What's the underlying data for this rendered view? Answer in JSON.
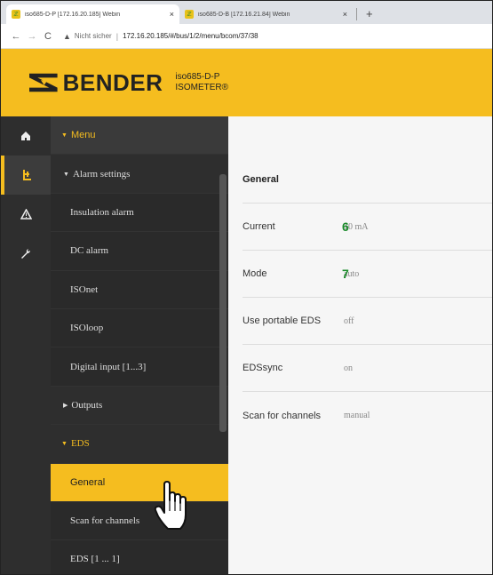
{
  "browser": {
    "tabs": [
      {
        "label": "iso685-D-P [172.16.20.185] Webin",
        "close": "×",
        "active": true
      },
      {
        "label": "iso685-D-B [172.16.21.84] Webin",
        "close": "×",
        "active": false
      }
    ],
    "new_tab": "+",
    "back": "←",
    "forward": "→",
    "reload": "C",
    "security_label": "Nicht sicher",
    "url_separator": "|",
    "url": "172.16.20.185/#/bus/1/2/menu/bcom/37/38"
  },
  "header": {
    "brand": "BENDER",
    "device_line1": "iso685-D-P",
    "device_line2": "ISOMETER®"
  },
  "rail": {
    "items": [
      {
        "icon": "home-icon",
        "glyph": "⌂"
      },
      {
        "icon": "settings-tree-icon",
        "glyph": "⊩"
      },
      {
        "icon": "warning-icon",
        "glyph": "⚠"
      },
      {
        "icon": "wrench-icon",
        "glyph": "✎"
      }
    ]
  },
  "menu": {
    "head": "Menu",
    "items": [
      "Alarm settings",
      "Insulation alarm",
      "DC alarm",
      "ISOnet",
      "ISOloop",
      "Digital input [1...3]",
      "Outputs",
      "EDS",
      "General",
      "Scan for channels",
      "EDS [1 ... 1]"
    ]
  },
  "content": {
    "title": "General",
    "rows": [
      {
        "label": "Current",
        "value": "10 mA",
        "marker": "6"
      },
      {
        "label": "Mode",
        "value": "auto",
        "marker": "7"
      },
      {
        "label": "Use portable EDS",
        "value": "off"
      },
      {
        "label": "EDSsync",
        "value": "on"
      },
      {
        "label": "Scan for channels",
        "value": "manual"
      }
    ]
  },
  "colors": {
    "accent": "#f5bd1f",
    "menu_bg": "#3a3a3a",
    "marker": "#1a8a2a"
  }
}
